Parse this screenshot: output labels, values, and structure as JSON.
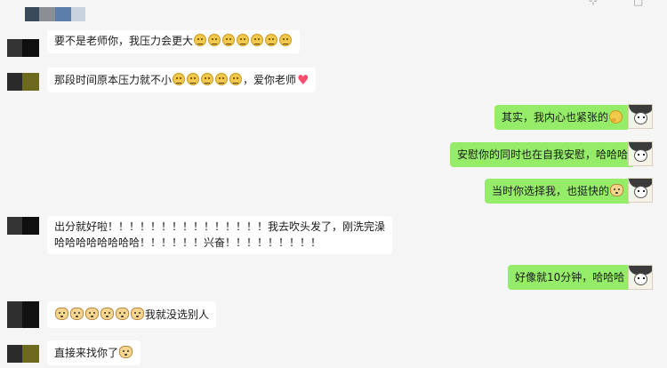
{
  "window": {
    "controls": [
      "⊹",
      "□"
    ]
  },
  "messages": [
    {
      "side": "left",
      "parts": [
        "要不是老师你，我压力会更大"
      ],
      "emoji": [
        "grin",
        "grin",
        "grin",
        "grin",
        "grin",
        "grin",
        "grin"
      ]
    },
    {
      "side": "left",
      "parts": [
        "那段时间原本压力就不小",
        "，爱你老师"
      ],
      "emoji": [
        "grin",
        "grin",
        "grin",
        "grin",
        "grin"
      ]
    },
    {
      "side": "right",
      "parts": [
        "其实，我内心也紧张的"
      ],
      "emoji": [
        "thinking"
      ]
    },
    {
      "side": "right",
      "parts": [
        "安慰你的同时也在自我安慰，哈哈哈"
      ]
    },
    {
      "side": "right",
      "parts": [
        "当时你选择我，也挺快的"
      ],
      "emoji": [
        "doge"
      ]
    },
    {
      "side": "left",
      "parts": [
        "出分就好啦！！！！！！！！！！！！！！！我去吹头发了，刚洗完澡哈哈哈哈哈哈哈哈！！！！！！兴奋！！！！！！！！！"
      ]
    },
    {
      "side": "right",
      "parts": [
        "好像就10分钟，哈哈哈"
      ]
    },
    {
      "side": "left",
      "parts": [
        "我就没选别人"
      ],
      "emoji": [
        "doge",
        "doge",
        "doge",
        "doge",
        "doge",
        "doge"
      ]
    },
    {
      "side": "left",
      "parts": [
        "直接来找你了"
      ],
      "emoji": [
        "doge"
      ]
    }
  ],
  "colors": {
    "background": "#f5f5f5",
    "bubble_other": "#ffffff",
    "bubble_self": "#95ec69",
    "heart": "#ff4d6d"
  },
  "icons": [
    "avatar-blurred",
    "avatar-self",
    "grin-emoji",
    "thinking-emoji",
    "doge-emoji",
    "heart-icon"
  ]
}
